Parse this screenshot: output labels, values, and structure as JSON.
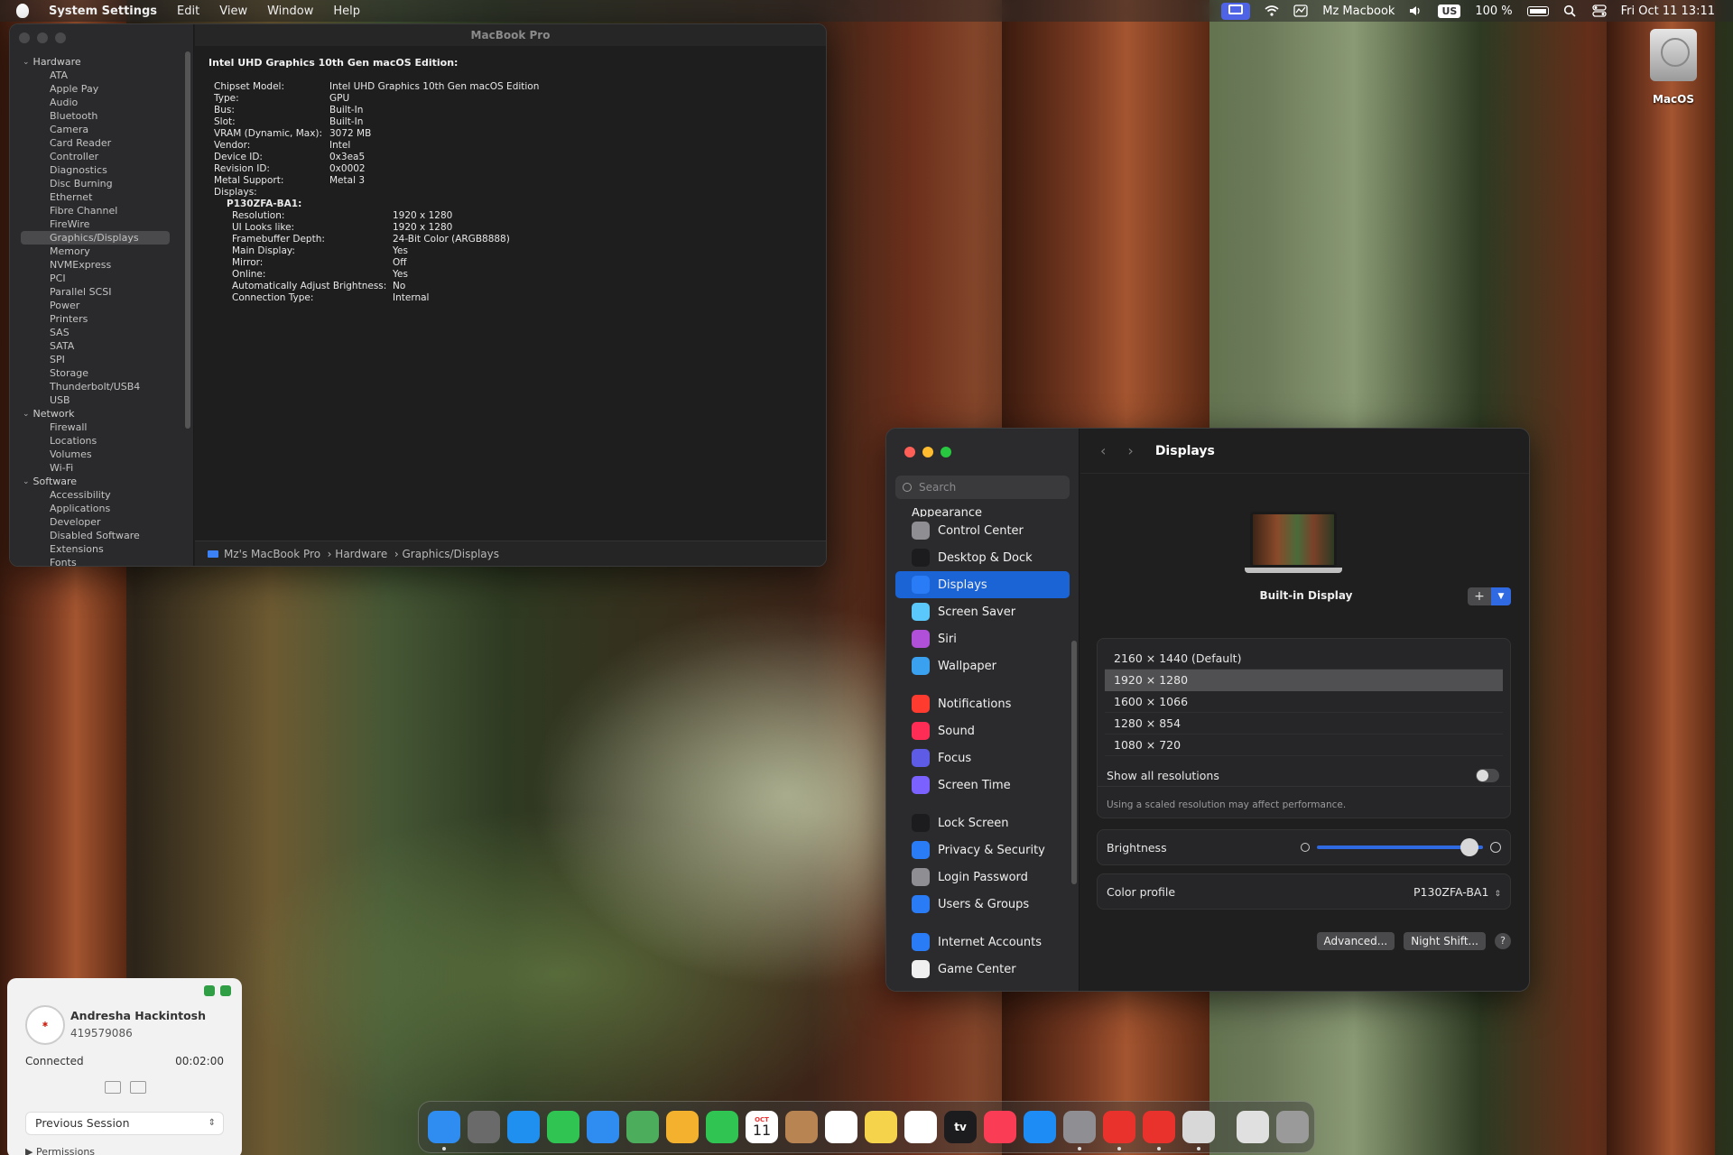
{
  "menubar": {
    "app_name": "System Settings",
    "menus": [
      "Edit",
      "View",
      "Window",
      "Help"
    ],
    "computer_name": "Mz Macbook",
    "input_source": "US",
    "battery": "100 %",
    "datetime": "Fri Oct 11  13:11"
  },
  "sysinfo": {
    "window_title": "MacBook Pro",
    "sidebar": {
      "hardware_label": "Hardware",
      "hardware_items": [
        "ATA",
        "Apple Pay",
        "Audio",
        "Bluetooth",
        "Camera",
        "Card Reader",
        "Controller",
        "Diagnostics",
        "Disc Burning",
        "Ethernet",
        "Fibre Channel",
        "FireWire",
        "Graphics/Displays",
        "Memory",
        "NVMExpress",
        "PCI",
        "Parallel SCSI",
        "Power",
        "Printers",
        "SAS",
        "SATA",
        "SPI",
        "Storage",
        "Thunderbolt/USB4",
        "USB"
      ],
      "network_label": "Network",
      "network_items": [
        "Firewall",
        "Locations",
        "Volumes",
        "Wi-Fi"
      ],
      "software_label": "Software",
      "software_items": [
        "Accessibility",
        "Applications",
        "Developer",
        "Disabled Software",
        "Extensions",
        "Fonts"
      ],
      "selected": "Graphics/Displays"
    },
    "heading": "Intel UHD Graphics 10th Gen macOS Edition:",
    "details": [
      {
        "k": "Chipset Model:",
        "v": "Intel UHD Graphics 10th Gen macOS Edition"
      },
      {
        "k": "Type:",
        "v": "GPU"
      },
      {
        "k": "Bus:",
        "v": "Built-In"
      },
      {
        "k": "Slot:",
        "v": "Built-In"
      },
      {
        "k": "VRAM (Dynamic, Max):",
        "v": "3072 MB"
      },
      {
        "k": "Vendor:",
        "v": "Intel"
      },
      {
        "k": "Device ID:",
        "v": "0x3ea5"
      },
      {
        "k": "Revision ID:",
        "v": "0x0002"
      },
      {
        "k": "Metal Support:",
        "v": "Metal 3"
      },
      {
        "k": "Displays:",
        "v": ""
      }
    ],
    "display_name": "P130ZFA-BA1:",
    "display_details": [
      {
        "k": "Resolution:",
        "v": "1920 x 1280"
      },
      {
        "k": "UI Looks like:",
        "v": "1920 x 1280"
      },
      {
        "k": "Framebuffer Depth:",
        "v": "24-Bit Color (ARGB8888)"
      },
      {
        "k": "Main Display:",
        "v": "Yes"
      },
      {
        "k": "Mirror:",
        "v": "Off"
      },
      {
        "k": "Online:",
        "v": "Yes"
      },
      {
        "k": "Automatically Adjust Brightness:",
        "v": "No"
      },
      {
        "k": "Connection Type:",
        "v": "Internal"
      }
    ],
    "breadcrumb": [
      "Mz's MacBook Pro",
      "Hardware",
      "Graphics/Displays"
    ]
  },
  "settings": {
    "search_placeholder": "Search",
    "partial_item": "Appearance",
    "items_group1": [
      {
        "label": "Control Center",
        "color": "#8e8e93"
      },
      {
        "label": "Desktop & Dock",
        "color": "#1c1c1e"
      },
      {
        "label": "Displays",
        "color": "#2a7cf6"
      },
      {
        "label": "Screen Saver",
        "color": "#5ac8fa"
      },
      {
        "label": "Siri",
        "color": "#b04fd8"
      },
      {
        "label": "Wallpaper",
        "color": "#3aa0f0"
      }
    ],
    "items_group2": [
      {
        "label": "Notifications",
        "color": "#ff3b30"
      },
      {
        "label": "Sound",
        "color": "#ff2d55"
      },
      {
        "label": "Focus",
        "color": "#5e5ce6"
      },
      {
        "label": "Screen Time",
        "color": "#7b61ff"
      }
    ],
    "items_group3": [
      {
        "label": "Lock Screen",
        "color": "#1c1c1e"
      },
      {
        "label": "Privacy & Security",
        "color": "#2a7cf6"
      },
      {
        "label": "Login Password",
        "color": "#8e8e93"
      },
      {
        "label": "Users & Groups",
        "color": "#2a7cf6"
      }
    ],
    "items_group4": [
      {
        "label": "Internet Accounts",
        "color": "#2a7cf6"
      },
      {
        "label": "Game Center",
        "color": "#f0f0f0"
      }
    ],
    "selected": "Displays",
    "page_title": "Displays",
    "display_label": "Built-in Display",
    "resolutions": [
      "2160 × 1440 (Default)",
      "1920 × 1280",
      "1600 × 1066",
      "1280 × 854",
      "1080 × 720"
    ],
    "selected_resolution": "1920 × 1280",
    "show_all_label": "Show all resolutions",
    "show_all_on": false,
    "note": "Using a scaled resolution may affect performance.",
    "brightness_label": "Brightness",
    "brightness_level": 0.92,
    "color_profile_label": "Color profile",
    "color_profile_value": "P130ZFA-BA1",
    "advanced_label": "Advanced...",
    "night_shift_label": "Night Shift...",
    "help_label": "?"
  },
  "desktop": {
    "disk_label": "MacOS"
  },
  "remote": {
    "name": "Andresha Hackintosh",
    "id": "419579086",
    "status": "Connected",
    "duration": "00:02:00",
    "session_select": "Previous Session",
    "permissions": "Permissions"
  },
  "dock": {
    "apps": [
      {
        "name": "Finder",
        "color": "#2f8cf0",
        "running": true
      },
      {
        "name": "Launchpad",
        "color": "#6a6a6a",
        "running": false
      },
      {
        "name": "Safari",
        "color": "#1f8ff0",
        "running": false
      },
      {
        "name": "Messages",
        "color": "#30c552",
        "running": false
      },
      {
        "name": "Mail",
        "color": "#2f8cf0",
        "running": false
      },
      {
        "name": "Maps",
        "color": "#4cae5c",
        "running": false
      },
      {
        "name": "Photos",
        "color": "#f3b12e",
        "running": false
      },
      {
        "name": "FaceTime",
        "color": "#30c552",
        "running": false
      },
      {
        "name": "Calendar",
        "color": "#ffffff",
        "running": false
      },
      {
        "name": "Contacts",
        "color": "#b88552",
        "running": false
      },
      {
        "name": "Reminders",
        "color": "#ffffff",
        "running": false
      },
      {
        "name": "Notes",
        "color": "#f5d34b",
        "running": false
      },
      {
        "name": "Freeform",
        "color": "#ffffff",
        "running": false
      },
      {
        "name": "TV",
        "color": "#1c1c1e",
        "running": false
      },
      {
        "name": "Music",
        "color": "#fa3c55",
        "running": false
      },
      {
        "name": "App Store",
        "color": "#1d8cf5",
        "running": false
      },
      {
        "name": "System Settings",
        "color": "#8e8e93",
        "running": true
      },
      {
        "name": "AnyDesk",
        "color": "#e9322c",
        "running": true
      },
      {
        "name": "AnyDesk Session",
        "color": "#e9322c",
        "running": true
      },
      {
        "name": "System Information",
        "color": "#d8d8d8",
        "running": true
      }
    ],
    "extras": [
      {
        "name": "Document",
        "color": "#e0e0e0"
      },
      {
        "name": "Trash",
        "color": "#9a9a9a"
      }
    ],
    "calendar_month": "OCT",
    "calendar_day": "11",
    "tv_label": "tv"
  }
}
